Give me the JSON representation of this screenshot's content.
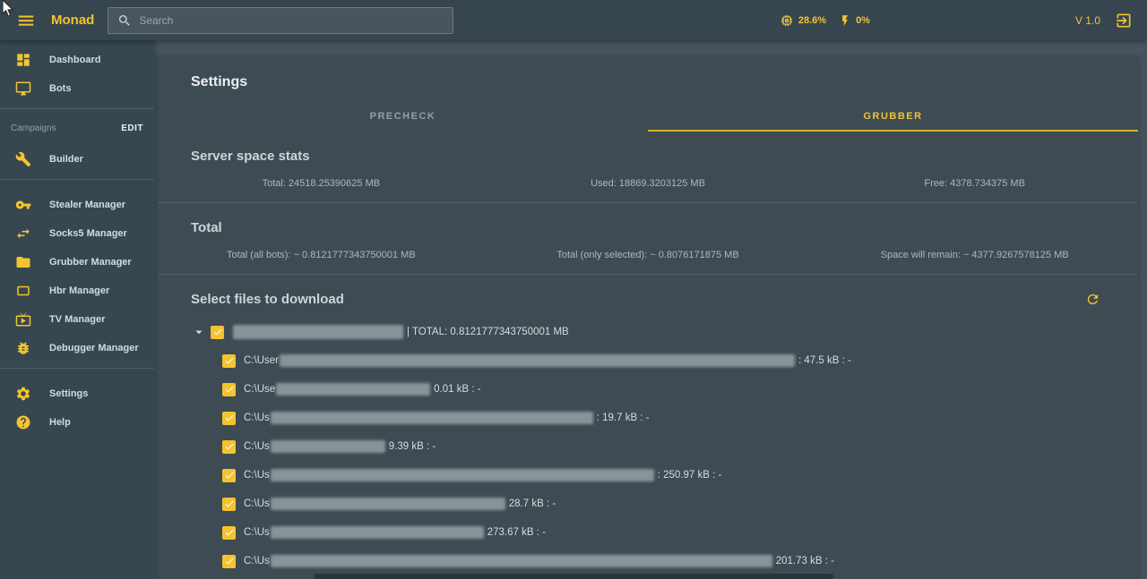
{
  "topbar": {
    "brand": "Monad",
    "search_placeholder": "Search",
    "cpu_value": "28.6%",
    "power_value": "0%",
    "version": "V 1.0"
  },
  "sidebar": {
    "top_items": [
      {
        "label": "Dashboard"
      },
      {
        "label": "Bots"
      }
    ],
    "campaigns": {
      "label": "Campaigns",
      "edit": "EDIT"
    },
    "builder_label": "Builder",
    "manager_items": [
      "Stealer Manager",
      "Socks5 Manager",
      "Grubber Manager",
      "Hbr Manager",
      "TV Manager",
      "Debugger Manager"
    ],
    "bottom_items": [
      "Settings",
      "Help"
    ]
  },
  "page": {
    "title": "Settings",
    "tabs": [
      {
        "label": "PRECHECK"
      },
      {
        "label": "GRUBBER"
      }
    ]
  },
  "server_space": {
    "title": "Server space stats",
    "stats": [
      "Total: 24518.25390625 MB",
      "Used: 18869.3203125 MB",
      "Free: 4378.734375 MB"
    ]
  },
  "total_section": {
    "title": "Total",
    "stats": [
      "Total (all bots): ~ 0.8121777343750001 MB",
      "Total (only selected): ~ 0.8076171875 MB",
      "Space will remain: ~ 4377.9267578125 MB"
    ]
  },
  "files_section": {
    "title": "Select files to download",
    "root_suffix": "| TOTAL: 0.8121777343750001 MB",
    "rows": [
      {
        "prefix": "C:\\User",
        "suffix": ": 47.5 kB : -"
      },
      {
        "prefix": "C:\\Use",
        "suffix": "0.01 kB : -"
      },
      {
        "prefix": "C:\\Us",
        "suffix": ": 19.7 kB : -"
      },
      {
        "prefix": "C:\\Us",
        "suffix": "9.39 kB : -"
      },
      {
        "prefix": "C:\\Us",
        "suffix": ": 250.97 kB : -"
      },
      {
        "prefix": "C:\\Us",
        "suffix": "28.7 kB : -"
      },
      {
        "prefix": "C:\\Us",
        "suffix": "273.67 kB : -"
      },
      {
        "prefix": "C:\\Us",
        "suffix": "201.73 kB : -"
      }
    ]
  },
  "colors": {
    "accent": "#f4c430",
    "topbar_bg": "#36454e",
    "sidebar_bg": "#37474f",
    "card_bg": "#3e4b53",
    "main_bg": "#46545d"
  }
}
